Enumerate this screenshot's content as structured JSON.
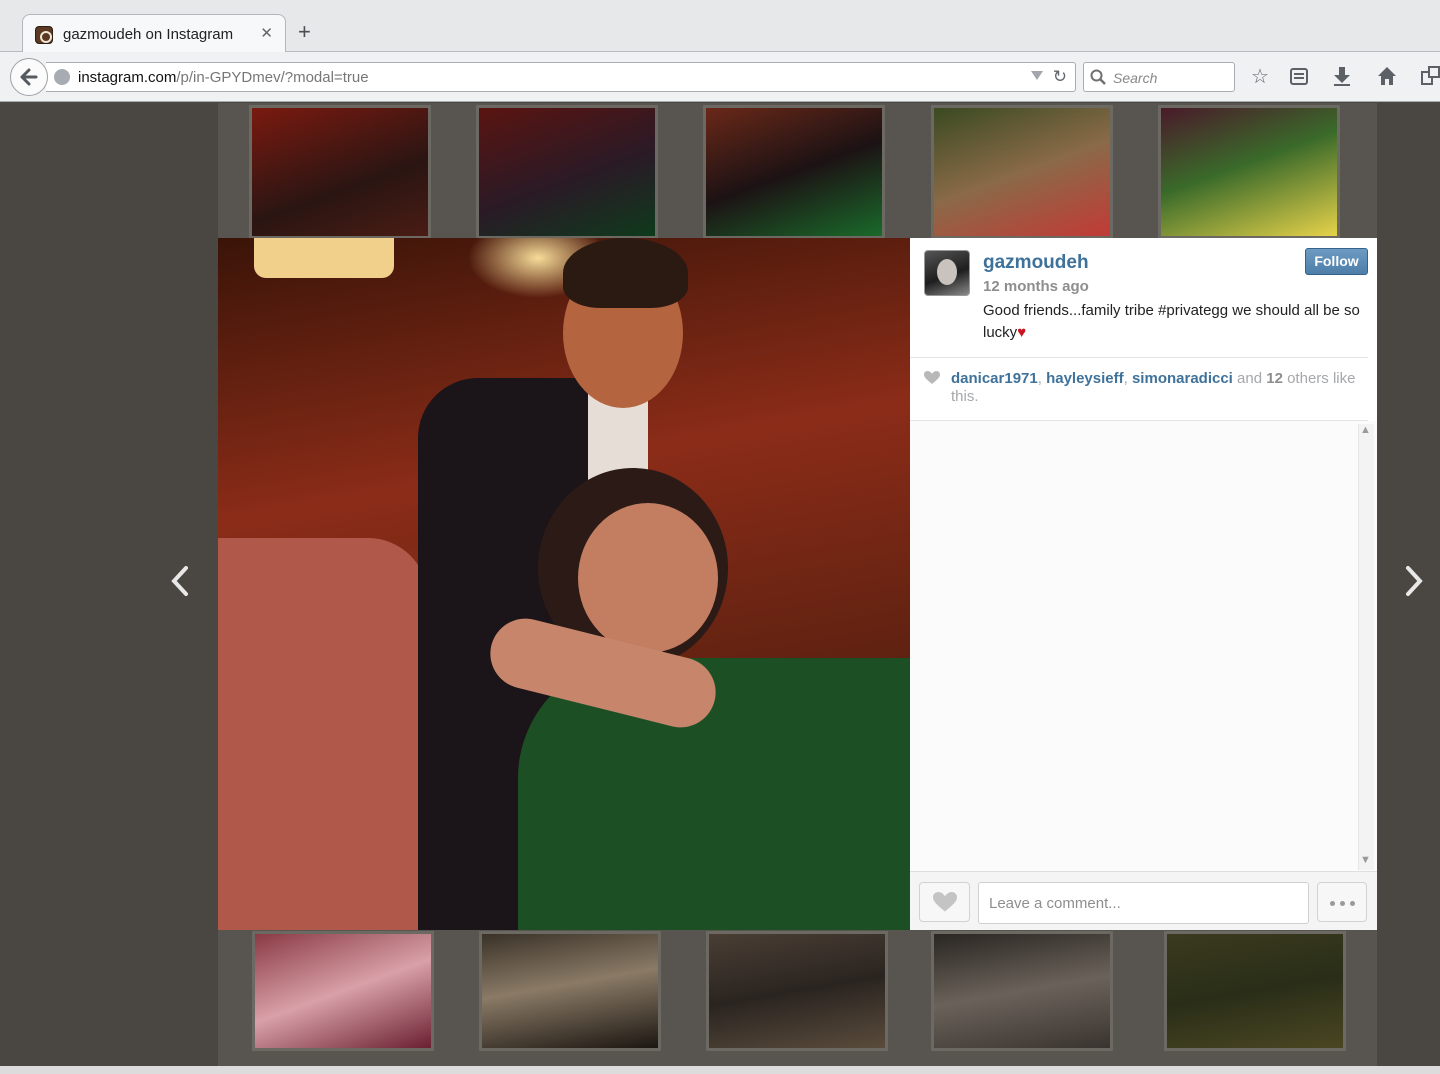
{
  "browser": {
    "tab_title": "gazmoudeh on Instagram",
    "tab_close": "✕",
    "new_tab": "+",
    "url_host": "instagram.com",
    "url_path": "/p/in-GPYDmev/?modal=true",
    "search_placeholder": "Search"
  },
  "post": {
    "username": "gazmoudeh",
    "time_ago": "12 months ago",
    "follow_label": "Follow",
    "caption": "Good friends...family tribe #privategg we should all be so lucky",
    "caption_emoji": "♥",
    "likes": {
      "users": [
        "danicar1971",
        "hayleysieff",
        "simonaradicci"
      ],
      "sep": ", ",
      "and_text": " and ",
      "others_count": "12",
      "suffix": " others like this."
    },
    "comment_placeholder": "Leave a comment..."
  },
  "colors": {
    "username_blue": "#3f729b",
    "follow_bg": "#5a8ab5",
    "heart_red": "#c91521"
  },
  "icons": [
    "back-arrow-icon",
    "globe-icon",
    "dropdown-icon",
    "reload-icon",
    "search-icon",
    "star-icon",
    "reading-list-icon",
    "download-icon",
    "home-icon",
    "share-icon",
    "heart-icon",
    "more-icon",
    "chevron-left-icon",
    "chevron-right-icon"
  ]
}
